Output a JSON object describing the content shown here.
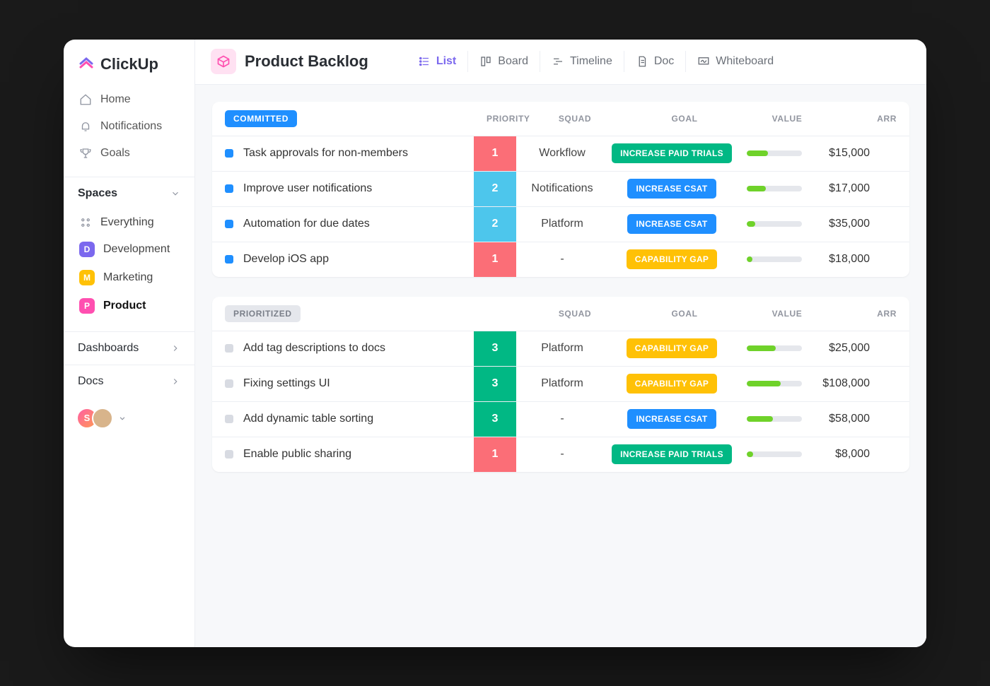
{
  "app": {
    "brand": "ClickUp"
  },
  "sidebar": {
    "nav": [
      {
        "icon": "home",
        "label": "Home"
      },
      {
        "icon": "bell",
        "label": "Notifications"
      },
      {
        "icon": "trophy",
        "label": "Goals"
      }
    ],
    "spaces_header": "Spaces",
    "everything": "Everything",
    "spaces": [
      {
        "initial": "D",
        "label": "Development",
        "cls": "dev"
      },
      {
        "initial": "M",
        "label": "Marketing",
        "cls": "mkt"
      },
      {
        "initial": "P",
        "label": "Product",
        "cls": "prod",
        "active": true
      }
    ],
    "rows": [
      {
        "label": "Dashboards"
      },
      {
        "label": "Docs"
      }
    ],
    "avatars": [
      {
        "initial": "S"
      },
      {
        "initial": ""
      }
    ]
  },
  "header": {
    "title": "Product Backlog",
    "views": [
      {
        "icon": "list",
        "label": "List",
        "active": true
      },
      {
        "icon": "board",
        "label": "Board"
      },
      {
        "icon": "timeline",
        "label": "Timeline"
      },
      {
        "icon": "doc",
        "label": "Doc"
      },
      {
        "icon": "whiteboard",
        "label": "Whiteboard"
      }
    ]
  },
  "columns": {
    "priority": "PRIORITY",
    "squad": "SQUAD",
    "goal": "GOAL",
    "value": "VALUE",
    "arr": "ARR"
  },
  "groups": [
    {
      "status": "COMMITTED",
      "chip_class": "chip-committed",
      "dot": "blue",
      "show_priority_header": true,
      "tasks": [
        {
          "title": "Task approvals for non-members",
          "priority": "1",
          "prio_class": "p-red",
          "squad": "Workflow",
          "goal": "INCREASE PAID TRIALS",
          "goal_class": "g-green",
          "value_pct": 38,
          "arr": "$15,000"
        },
        {
          "title": "Improve  user notifications",
          "priority": "2",
          "prio_class": "p-teal",
          "squad": "Notifications",
          "goal": "INCREASE CSAT",
          "goal_class": "g-blue",
          "value_pct": 34,
          "arr": "$17,000"
        },
        {
          "title": "Automation for due dates",
          "priority": "2",
          "prio_class": "p-teal",
          "squad": "Platform",
          "goal": "INCREASE CSAT",
          "goal_class": "g-blue",
          "value_pct": 15,
          "arr": "$35,000"
        },
        {
          "title": "Develop iOS app",
          "priority": "1",
          "prio_class": "p-red",
          "squad": "-",
          "goal": "CAPABILITY GAP",
          "goal_class": "g-yellow",
          "value_pct": 10,
          "arr": "$18,000"
        }
      ]
    },
    {
      "status": "PRIORITIZED",
      "chip_class": "chip-prioritized",
      "dot": "grey",
      "show_priority_header": false,
      "tasks": [
        {
          "title": "Add tag descriptions to docs",
          "priority": "3",
          "prio_class": "p-green",
          "squad": "Platform",
          "goal": "CAPABILITY GAP",
          "goal_class": "g-yellow",
          "value_pct": 52,
          "arr": "$25,000"
        },
        {
          "title": "Fixing settings UI",
          "priority": "3",
          "prio_class": "p-green",
          "squad": "Platform",
          "goal": "CAPABILITY GAP",
          "goal_class": "g-yellow",
          "value_pct": 62,
          "arr": "$108,000"
        },
        {
          "title": "Add dynamic table sorting",
          "priority": "3",
          "prio_class": "p-green",
          "squad": "-",
          "goal": "INCREASE CSAT",
          "goal_class": "g-blue",
          "value_pct": 48,
          "arr": "$58,000"
        },
        {
          "title": "Enable public sharing",
          "priority": "1",
          "prio_class": "p-red",
          "squad": "-",
          "goal": "INCREASE PAID TRIALS",
          "goal_class": "g-green",
          "value_pct": 12,
          "arr": "$8,000"
        }
      ]
    }
  ]
}
